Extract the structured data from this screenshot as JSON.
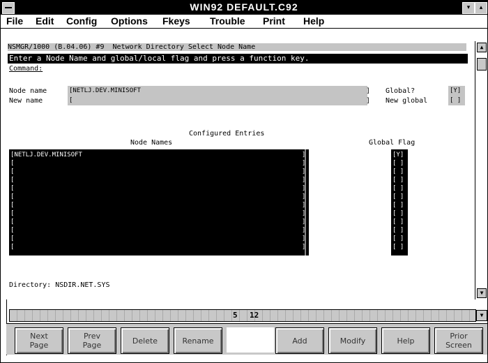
{
  "window": {
    "title": "WIN92 DEFAULT.C92",
    "max_glyph": "▾",
    "restore_glyph": "▴"
  },
  "menu": [
    "File",
    "Edit",
    "Config",
    "Options",
    "Fkeys",
    "Trouble",
    "Print",
    "Help"
  ],
  "screen": {
    "header_line": "NSMGR/1000 (B.04.06) #9  Network Directory Select Node Name",
    "prompt": "Enter a Node Name and global/local flag and press a function key.",
    "command_label": "Command:",
    "node_name_label": "Node name",
    "node_name_value": "[NETLJ.DEV.MINISOFT",
    "node_name_close": "]",
    "new_name_label": "New name",
    "new_name_value": "[",
    "new_name_close": "]",
    "global_label": "Global?",
    "global_value": "[Y]",
    "new_global_label": "New global",
    "new_global_value": "[ ]",
    "configured_heading": "Configured Entries",
    "node_names_heading": "Node Names",
    "global_flag_heading": "Global Flag",
    "entries": [
      "[NETLJ.DEV.MINISOFT",
      "[",
      "[",
      "[",
      "[",
      "[",
      "[",
      "[",
      "[",
      "[",
      "[",
      "["
    ],
    "entry_close": "]",
    "flags": [
      "[Y]",
      "[ ]",
      "[ ]",
      "[ ]",
      "[ ]",
      "[ ]",
      "[ ]",
      "[ ]",
      "[ ]",
      "[ ]",
      "[ ]",
      "[ ]"
    ],
    "directory": "Directory: NSDIR.NET.SYS"
  },
  "status": {
    "left": "5",
    "right": "12"
  },
  "fkeys": {
    "f1": "Next\nPage",
    "f2": "Prev\nPage",
    "f3": "Delete",
    "f4": "Rename",
    "f5": "",
    "f6": "Add",
    "f7": "Modify",
    "f8": "Help",
    "f9": "Prior\nScreen"
  }
}
